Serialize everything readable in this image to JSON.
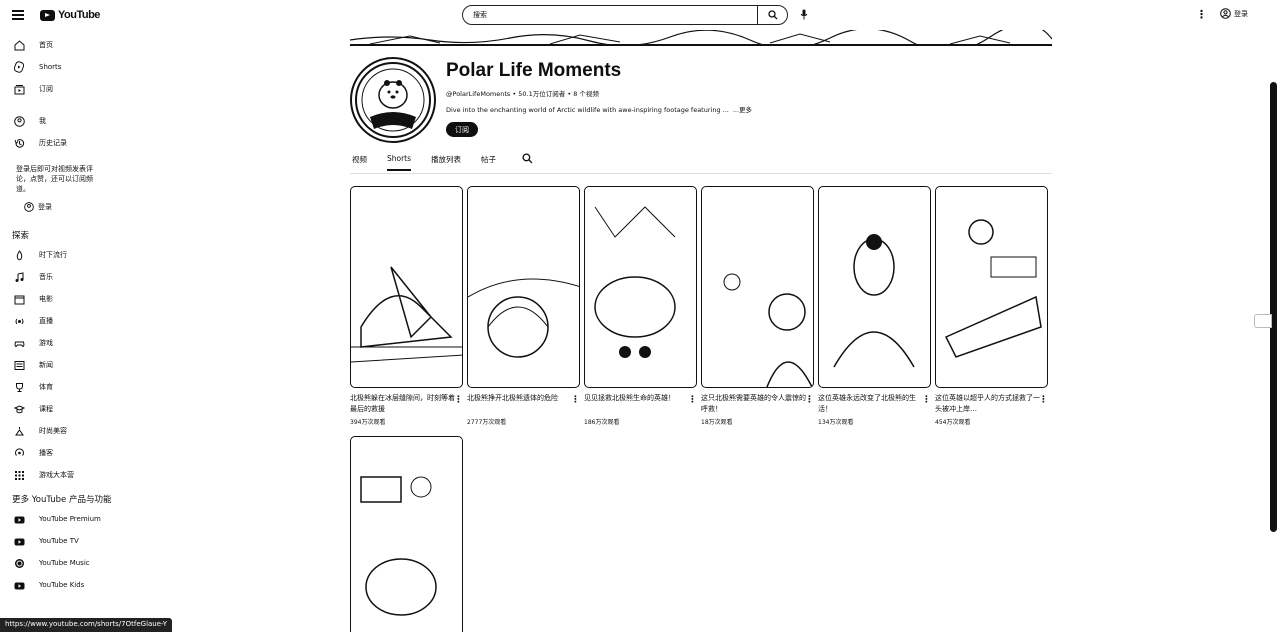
{
  "topbar": {
    "logo_text": "YouTube",
    "search_placeholder": "搜索",
    "signin": "登录"
  },
  "sidebar": {
    "main": [
      {
        "label": "首页",
        "icon": "home-icon"
      },
      {
        "label": "Shorts",
        "icon": "shorts-icon"
      },
      {
        "label": "订阅",
        "icon": "subscriptions-icon"
      }
    ],
    "you": [
      {
        "label": "我",
        "icon": "you-icon"
      },
      {
        "label": "历史记录",
        "icon": "history-icon"
      }
    ],
    "signin_note": "登录后即可对视频发表评论，点赞，还可以订阅频道。",
    "signin_label": "登录",
    "explore_heading": "探索",
    "explore": [
      {
        "label": "时下流行",
        "icon": "trending-icon"
      },
      {
        "label": "音乐",
        "icon": "music-icon"
      },
      {
        "label": "电影",
        "icon": "movies-icon"
      },
      {
        "label": "直播",
        "icon": "live-icon"
      },
      {
        "label": "游戏",
        "icon": "gaming-icon"
      },
      {
        "label": "新闻",
        "icon": "news-icon"
      },
      {
        "label": "体育",
        "icon": "sports-icon"
      },
      {
        "label": "课程",
        "icon": "courses-icon"
      },
      {
        "label": "时尚美容",
        "icon": "fashion-icon"
      },
      {
        "label": "播客",
        "icon": "podcast-icon"
      },
      {
        "label": "游戏大本营",
        "icon": "playables-icon"
      }
    ],
    "more_heading": "更多 YouTube 产品与功能",
    "more": [
      {
        "label": "YouTube Premium",
        "icon": "youtube-premium-icon"
      },
      {
        "label": "YouTube TV",
        "icon": "youtube-tv-icon"
      },
      {
        "label": "YouTube Music",
        "icon": "youtube-music-icon"
      },
      {
        "label": "YouTube Kids",
        "icon": "youtube-kids-icon"
      }
    ]
  },
  "channel": {
    "name": "Polar Life Moments",
    "meta": "@PolarLifeMoments • 50.1万位订阅者 • 8 个视频",
    "description": "Dive into the enchanting world of Arctic wildlife with awe-inspiring footage featuring ...",
    "more_link": "...更多",
    "subscribe": "订阅",
    "avatar_text": "Polar Life Moments"
  },
  "tabs": [
    "视频",
    "Shorts",
    "播放列表",
    "帖子"
  ],
  "active_tab": "Shorts",
  "shorts": [
    {
      "title": "北极熊躲在冰层缝隙间，时刻等着最后的救援",
      "views": "394万次观看"
    },
    {
      "title": "北极熊挣开北极熊遗体的危险",
      "views": "2777万次观看"
    },
    {
      "title": "见见拯救北极熊生命的英雄！",
      "views": "186万次观看"
    },
    {
      "title": "这只北极熊需要英雄的令人震惊的呼救！",
      "views": "18万次观看"
    },
    {
      "title": "这位英雄永远改变了北极熊的生活！",
      "views": "134万次观看"
    },
    {
      "title": "这位英雄以超乎人的方式拯救了一头被冲上岸…",
      "views": "454万次观看"
    },
    {
      "title": "",
      "views": ""
    }
  ],
  "status_url": "https://www.youtube.com/shorts/7OtfeGlaue-Y"
}
